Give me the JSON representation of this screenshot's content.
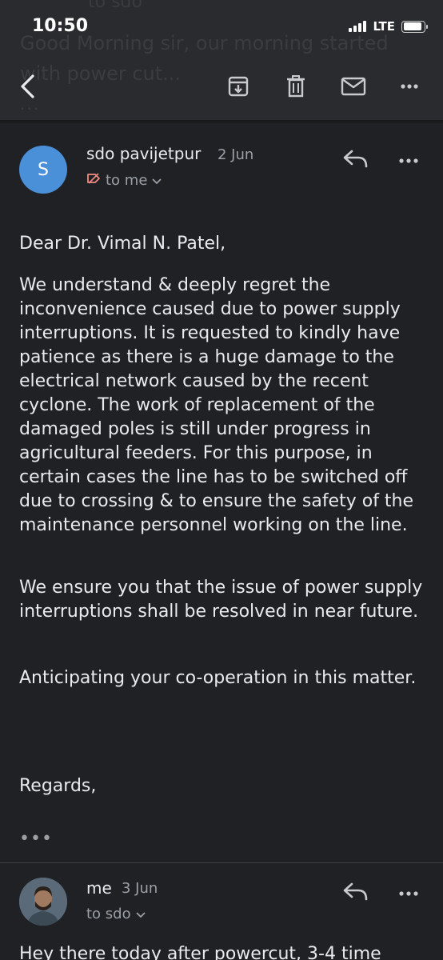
{
  "status_bar": {
    "time": "10:50",
    "network": "LTE",
    "battery_level": 0.9
  },
  "behind_header": {
    "sender_fragment": "to sdo",
    "line1": "Good Morning sir, our morning started",
    "line2": "with power cut...",
    "more": "..."
  },
  "toolbar": {
    "back": "back-icon",
    "archive": "archive-icon",
    "delete": "trash-icon",
    "mark_unread": "mail-icon",
    "more": "more-icon"
  },
  "message1": {
    "avatar_letter": "S",
    "avatar_color": "#4a90d9",
    "sender": "sdo pavijetpur",
    "date": "2 Jun",
    "recipient": "to me",
    "greeting": "Dear Dr. Vimal N. Patel,",
    "paragraph1": "We understand & deeply regret the inconvenience caused due to power supply interruptions. It is requested to kindly have patience as there is a huge damage to the electrical network caused by the recent cyclone. The work of replacement of the damaged poles is still under progress in agricultural feeders. For this purpose, in certain cases the line has to be switched off due to crossing & to ensure the safety of the maintenance personnel working on the line.",
    "paragraph2": "We ensure you that the issue of power supply interruptions shall be resolved in near future.",
    "paragraph3": "Anticipating your co-operation in this matter.",
    "closing": "Regards,",
    "trimmed": "•••"
  },
  "message2": {
    "sender": "me",
    "date": "3 Jun",
    "recipient": "to sdo",
    "preview": "Hey there today after powercut, 3-4 time"
  }
}
